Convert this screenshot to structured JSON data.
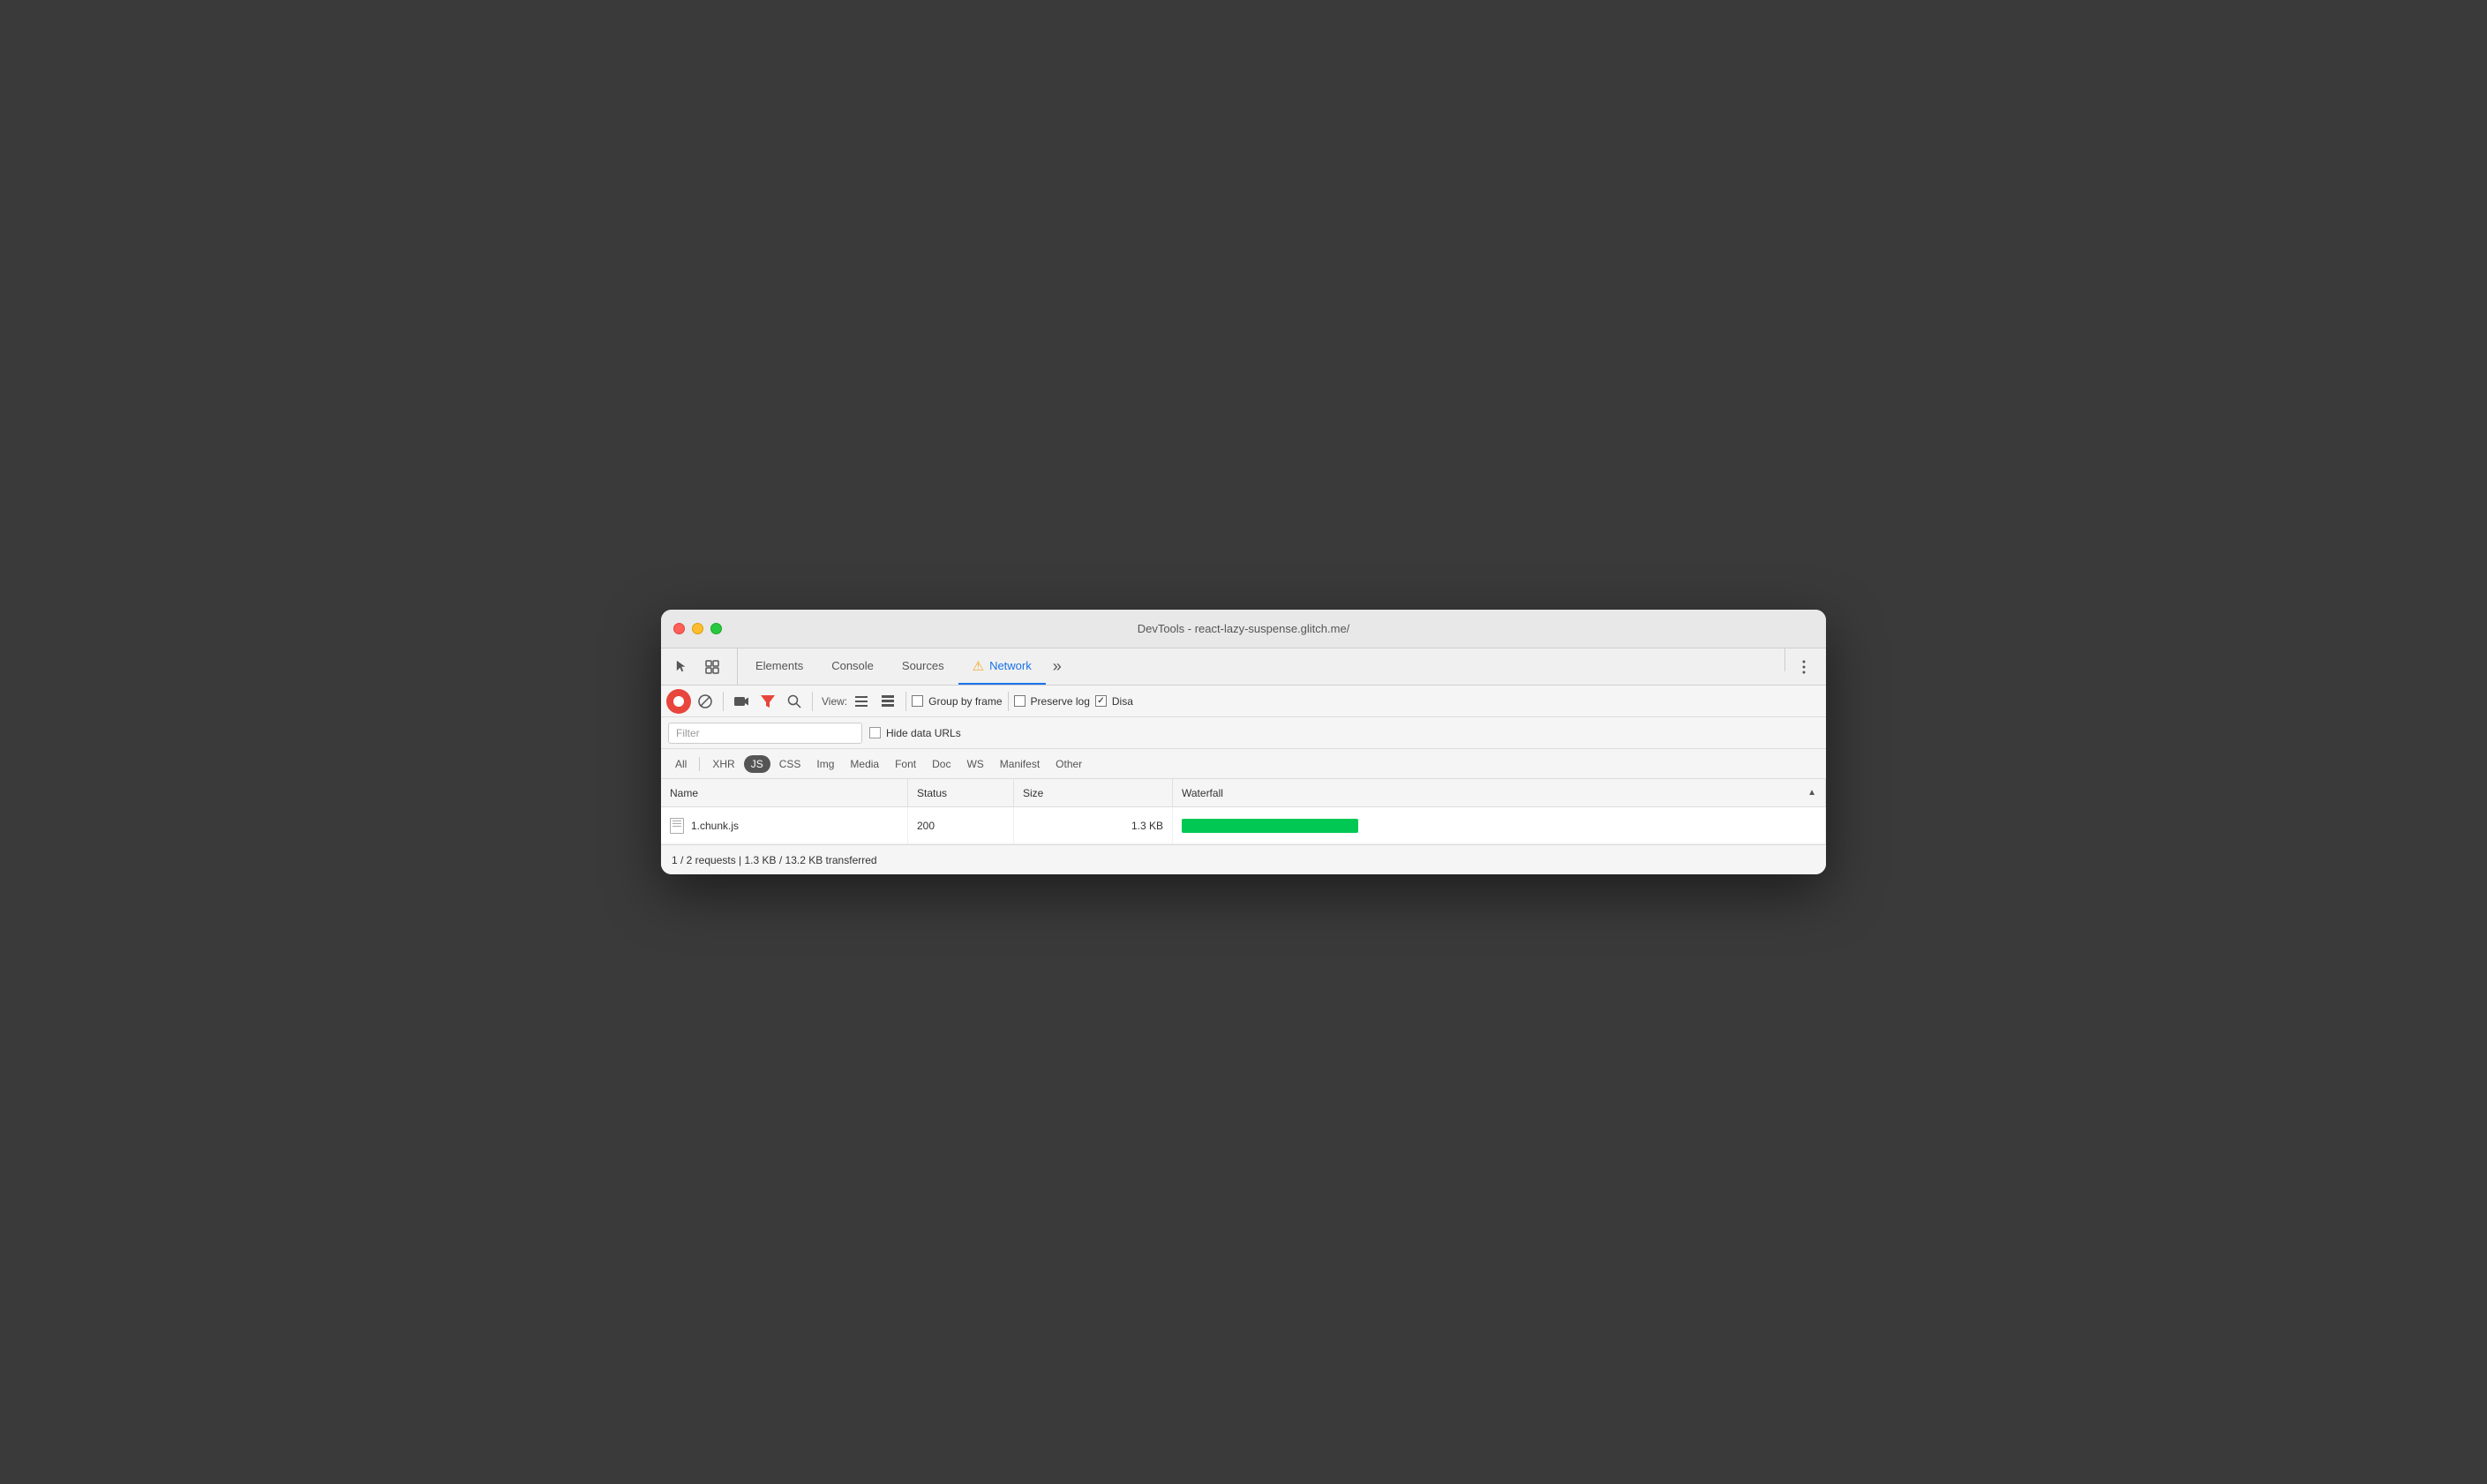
{
  "window": {
    "title": "DevTools - react-lazy-suspense.glitch.me/"
  },
  "tabs": {
    "items": [
      {
        "id": "elements",
        "label": "Elements",
        "active": false
      },
      {
        "id": "console",
        "label": "Console",
        "active": false
      },
      {
        "id": "sources",
        "label": "Sources",
        "active": false
      },
      {
        "id": "network",
        "label": "Network",
        "active": true
      },
      {
        "id": "more",
        "label": "»",
        "active": false
      }
    ]
  },
  "toolbar": {
    "view_label": "View:",
    "group_by_frame_label": "Group by frame",
    "preserve_log_label": "Preserve log",
    "disable_cache_label": "Disa"
  },
  "filter": {
    "placeholder": "Filter",
    "hide_data_urls_label": "Hide data URLs"
  },
  "type_filters": {
    "items": [
      {
        "id": "all",
        "label": "All"
      },
      {
        "id": "xhr",
        "label": "XHR"
      },
      {
        "id": "js",
        "label": "JS",
        "active": true
      },
      {
        "id": "css",
        "label": "CSS"
      },
      {
        "id": "img",
        "label": "Img"
      },
      {
        "id": "media",
        "label": "Media"
      },
      {
        "id": "font",
        "label": "Font"
      },
      {
        "id": "doc",
        "label": "Doc"
      },
      {
        "id": "ws",
        "label": "WS"
      },
      {
        "id": "manifest",
        "label": "Manifest"
      },
      {
        "id": "other",
        "label": "Other"
      }
    ]
  },
  "table": {
    "columns": [
      {
        "id": "name",
        "label": "Name"
      },
      {
        "id": "status",
        "label": "Status"
      },
      {
        "id": "size",
        "label": "Size"
      },
      {
        "id": "waterfall",
        "label": "Waterfall"
      }
    ],
    "rows": [
      {
        "name": "1.chunk.js",
        "status": "200",
        "size": "1.3 KB",
        "waterfall_width": 200,
        "waterfall_offset": 0
      }
    ]
  },
  "status_bar": {
    "text": "1 / 2 requests | 1.3 KB / 13.2 KB transferred"
  }
}
